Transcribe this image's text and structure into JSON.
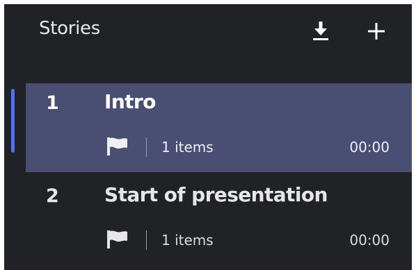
{
  "panel": {
    "title": "Stories",
    "download_icon": "download-icon",
    "add_icon": "plus-icon"
  },
  "stories": [
    {
      "number": "1",
      "title": "Intro",
      "items": "1 items",
      "duration": "00:00",
      "selected": true
    },
    {
      "number": "2",
      "title": "Start of presentation",
      "items": "1 items",
      "duration": "00:00",
      "selected": false
    }
  ],
  "colors": {
    "background": "#202226",
    "selected_row": "#4a4e72",
    "active_indicator": "#4d6fff",
    "text": "#ffffff"
  }
}
